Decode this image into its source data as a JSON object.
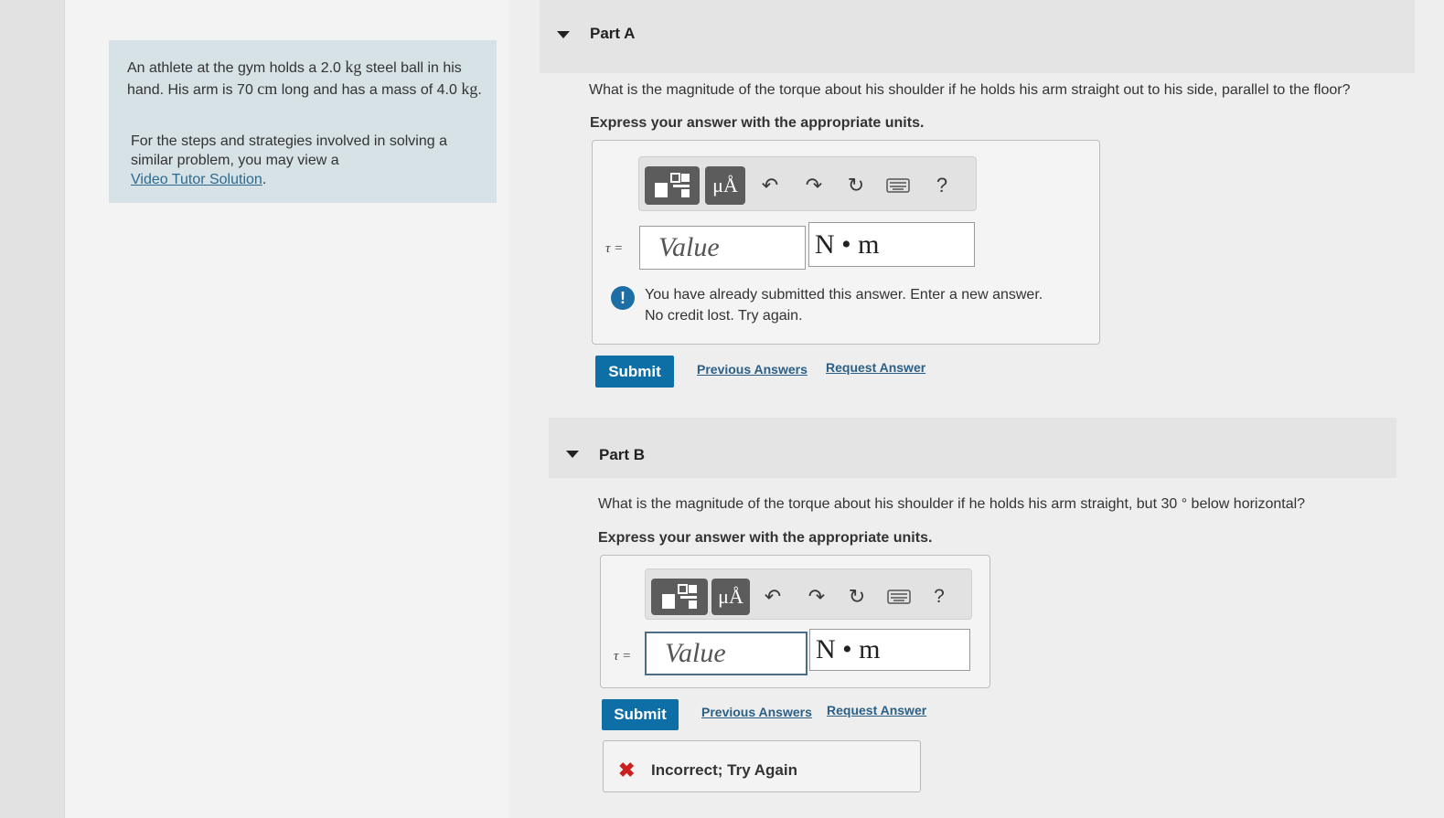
{
  "problem": {
    "text_a": "An athlete at the gym holds a 2.0",
    "unit_kg1": "kg",
    "text_b": "steel ball in his hand. His arm is 70",
    "unit_cm": "cm",
    "text_c": "long and has a mass of",
    "mass2": "4.0",
    "unit_kg2": "kg",
    "text_d": ".",
    "tutor_text": "For the steps and strategies involved in solving a similar problem, you may view a",
    "tutor_link": "Video Tutor Solution",
    "tutor_end": "."
  },
  "partA": {
    "title": "Part A",
    "question": "What is the magnitude of the torque about his shoulder if he holds his arm straight out to his side, parallel to the floor?",
    "instruction": "Express your answer with the appropriate units.",
    "symbol": "τ =",
    "value_placeholder": "Value",
    "units": "N • m",
    "alert_line1": "You have already submitted this answer. Enter a new answer.",
    "alert_line2": "No credit lost. Try again.",
    "submit": "Submit",
    "previous_answers": "Previous Answers",
    "request_answer": "Request Answer"
  },
  "partB": {
    "title": "Part B",
    "question": "What is the magnitude of the torque about his shoulder if he holds his arm straight, but 30 ° below horizontal?",
    "instruction": "Express your answer with the appropriate units.",
    "symbol": "τ =",
    "value_placeholder": "Value",
    "units": "N • m",
    "submit": "Submit",
    "previous_answers": "Previous Answers",
    "request_answer": "Request Answer",
    "feedback": "Incorrect; Try Again"
  },
  "toolbar": {
    "mu_label": "μÅ",
    "help_label": "?"
  },
  "icons": [
    "templates-icon",
    "units-icon",
    "undo-icon",
    "redo-icon",
    "reset-icon",
    "keyboard-icon",
    "help-icon",
    "collapse-caret-icon",
    "alert-icon",
    "incorrect-x-icon"
  ],
  "colors": {
    "submit": "#0e6ea6",
    "alert": "#1c6ea4",
    "incorrect": "#cc1f1f",
    "problem_bg": "#d6e2e6"
  }
}
